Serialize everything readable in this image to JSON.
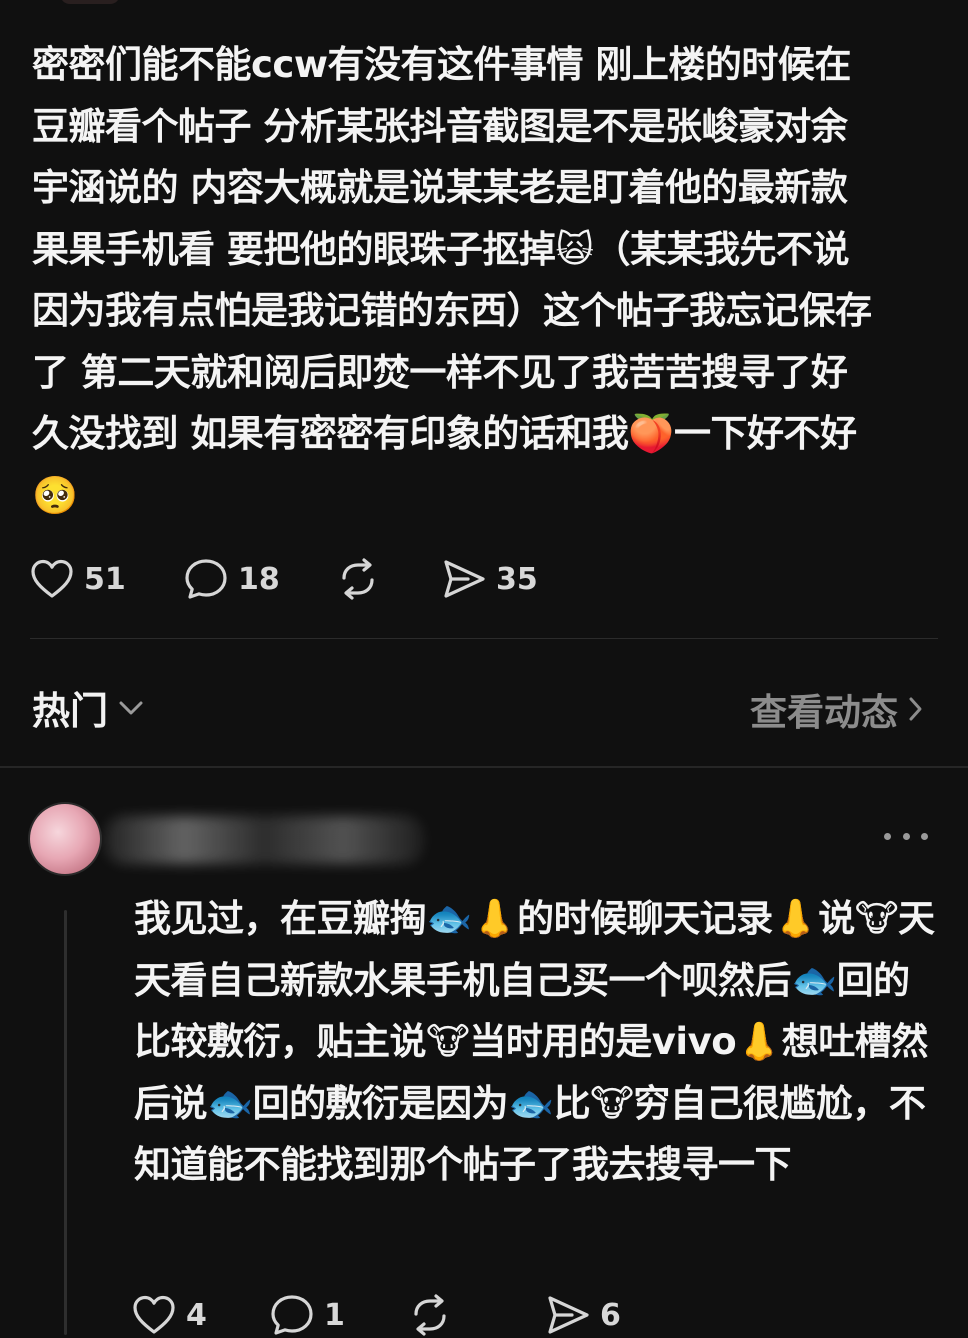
{
  "post": {
    "body": "密密们能不能ccw有没有这件事情 刚上楼的时候在豆瓣看个帖子 分析某张抖音截图是不是张峻豪对余宇涵说的 内容大概就是说某某老是盯着他的最新款果果手机看 要把他的眼珠子抠掉🙀（某某我先不说因为我有点怕是我记错的东西）这个帖子我忘记保存了 第二天就和阅后即焚一样不见了我苦苦搜寻了好久没找到 如果有密密有印象的话和我🍑一下好不好🥺",
    "likes": "51",
    "comments": "18",
    "shares": "35"
  },
  "sort": {
    "label": "热门",
    "view_activity": "查看动态"
  },
  "reply": {
    "body": "我见过，在豆瓣掏🐟👃的时候聊天记录👃说🐮天天看自己新款水果手机自己买一个呗然后🐟回的比较敷衍，贴主说🐮当时用的是vivo👃想吐槽然后说🐟回的敷衍是因为🐟比🐮穷自己很尴尬，不知道能不能找到那个帖子了我去搜寻一下",
    "likes": "4",
    "comments": "1",
    "shares": "6"
  },
  "icons": {
    "like": "heart-icon",
    "comment": "comment-bubble-icon",
    "repost": "repost-icon",
    "share": "send-icon",
    "dropdown": "chevron-down-icon",
    "forward": "chevron-right-icon",
    "more": "more-dots-icon"
  },
  "colors": {
    "background": "#101010",
    "text": "#f4f4f4",
    "muted": "#8c8c8c"
  }
}
